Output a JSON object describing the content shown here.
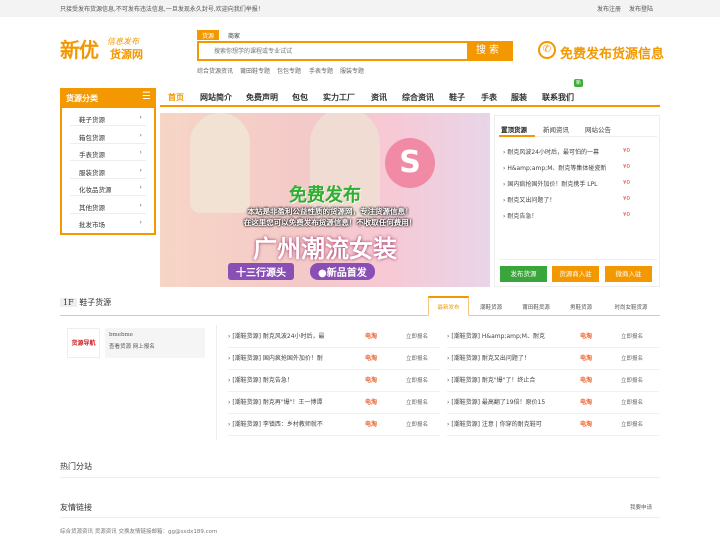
{
  "topbar": {
    "notice": "只接受发布货源信息,不可发布违法信息,一旦发现永久封号,欢迎向我们举报！",
    "register": "发布注册",
    "login": "发布登陆"
  },
  "logo": {
    "main": "新优",
    "slogan": "信息发布",
    "sub": "货源网"
  },
  "search": {
    "tabs": [
      "货源",
      "商家"
    ],
    "placeholder": "搜索你想学的课程或专业试试",
    "button": "搜索",
    "hot": [
      "综合货源资讯",
      "莆田鞋专题",
      "包包专题",
      "手表专题",
      "服装专题"
    ]
  },
  "publish_free": "免费发布货源信息",
  "nav": {
    "items": [
      "首页",
      "网站简介",
      "免费声明",
      "包包",
      "实力工厂",
      "资讯",
      "综合资讯",
      "鞋子",
      "手表",
      "服装",
      "联系我们"
    ],
    "badge": "新"
  },
  "sidebar": {
    "title": "货源分类",
    "items": [
      "鞋子货源",
      "箱包货源",
      "手表货源",
      "服装货源",
      "化妆品货源",
      "其他货源",
      "批发市场"
    ]
  },
  "banner": {
    "title": "免费发布",
    "line1": "本站是非盈利公益性质的货源网，专注货源信息！",
    "line2": "在这里您可以免费发布货源信息！不收取任何费用！",
    "headline": "广州潮流女装",
    "tag1": "十三行源头",
    "tag2": "●新品首发",
    "logo_letter": "S"
  },
  "right_panel": {
    "tabs": [
      "置顶货源",
      "新闻资讯",
      "网站公告"
    ],
    "items": [
      {
        "title": "耐克风波24小时后，最可怕的一幕",
        "price": "¥0"
      },
      {
        "title": "H&amp;amp;M、耐克等集体碰瓷新",
        "price": "¥0"
      },
      {
        "title": "国内疯抢国外加价！耐克携手 LPL",
        "price": "¥0"
      },
      {
        "title": "耐克又出问题了！",
        "price": "¥0"
      },
      {
        "title": "耐克告急！",
        "price": "¥0"
      }
    ],
    "buttons": [
      "发布货源",
      "货源商入驻",
      "微商入驻"
    ]
  },
  "floor": {
    "num": "1F",
    "title": "鞋子货源",
    "tabs": [
      "最新发布",
      "潮鞋货源",
      "莆田鞋货源",
      "男鞋货源",
      "时尚女鞋货源"
    ],
    "vendor": {
      "logo": "货源导航",
      "name": "bmebme",
      "links": "查看货源  网上报名"
    },
    "rows": [
      {
        "left": "[潮鞋货源] 耐克风波24小时后，最",
        "right": "[潮鞋货源] H&amp;amp;M、耐克"
      },
      {
        "left": "[潮鞋货源] 国内疯抢国外加价！耐",
        "right": "[潮鞋货源] 耐克又出问题了！"
      },
      {
        "left": "[潮鞋货源] 耐克告急！",
        "right": "[潮鞋货源] 耐克\"爆\"了！终止合"
      },
      {
        "left": "[潮鞋货源] 耐克再\"爆\"！王一博谭",
        "right": "[潮鞋货源] 最高翻了19倍！原价15"
      },
      {
        "left": "[潮鞋货源] 李镇西：乡村教师就不",
        "right": "[潮鞋货源] 注意 | 你穿的耐克鞋可"
      }
    ],
    "tag": "电淘",
    "action": "立即报名"
  },
  "hot_sites": "热门分站",
  "links": {
    "title": "友情链接",
    "apply": "我要申请",
    "footer": "综合货源资讯   货源资讯   交换友情链接邮箱：gg@sxdx189.com"
  }
}
